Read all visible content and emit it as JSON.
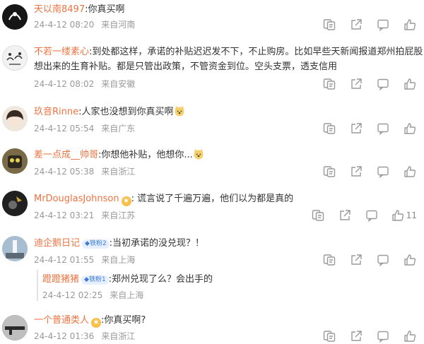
{
  "comments": [
    {
      "username": "天以南8497",
      "text": ":你真买啊",
      "date": "24-4-12 08:20",
      "location": "来自河南"
    },
    {
      "username": "不若一缕素心",
      "text": ":到处都这样，承诺的补贴迟迟发不下，不止购房。比如早些天新闻报道郑州拍屁股",
      "text2": "想出来的生育补贴。都是只管出政策，不管资金到位。空头支票，透支信用",
      "date": "24-4-12 08:02",
      "location": "来自安徽"
    },
    {
      "username": "玖音Rinne",
      "text": ":人家也没想到你真买啊",
      "date": "24-4-12 05:54",
      "location": "来自广东"
    },
    {
      "username": "差一点成__帅哥",
      "text": ":你想他补贴，他想你...",
      "date": "24-4-12 05:38",
      "location": "来自浙江"
    },
    {
      "username": "MrDouglasJohnson",
      "text": ": 谎言说了千遍万遍，他们以为都是真的",
      "date": "24-4-12 03:21",
      "location": "来自江苏",
      "likes": "11"
    },
    {
      "username": "迪企鹅日记",
      "badge": "铁粉2",
      "text": ":当初承诺的没兑现？！",
      "date": "24-4-12 01:55",
      "location": "来自上海"
    },
    {
      "username": "蹬蹬猪猪",
      "badge": "铁粉1",
      "text": ":郑州兑现了么？会出手的",
      "date": "24-4-12 02:25",
      "location": "来自上海"
    },
    {
      "username": "一个普通类人",
      "text": ":你真买啊?",
      "date": "24-4-12 01:36",
      "location": "来自浙江"
    }
  ],
  "colors": {
    "username": "#eb7340",
    "meta": "#999999",
    "fan_badge": "#3f7bd4"
  },
  "icons": [
    "comment-icon",
    "share-icon",
    "reply-icon",
    "like-icon"
  ]
}
